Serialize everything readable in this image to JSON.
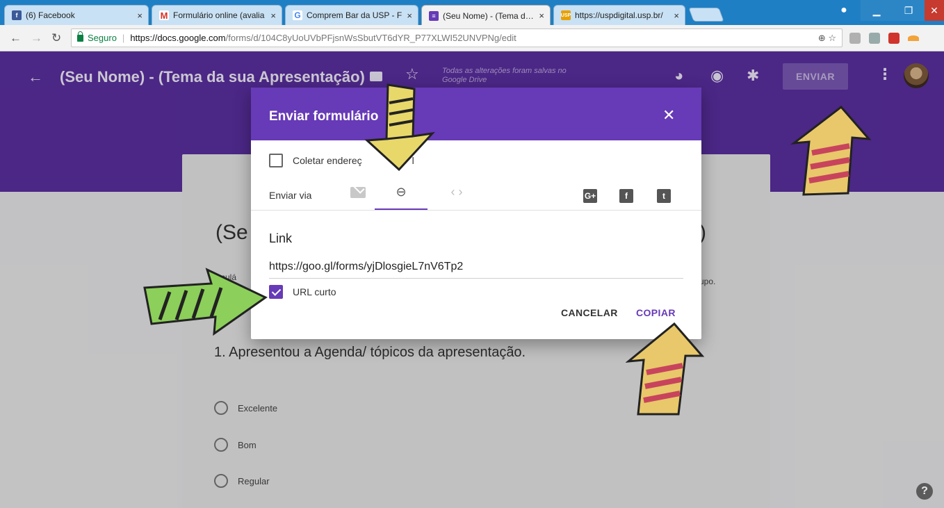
{
  "browser": {
    "tabs": [
      {
        "title": "(6) Facebook",
        "favicon": "facebook-icon",
        "color": "#3b5998"
      },
      {
        "title": "Formulário online (avalia",
        "favicon": "gmail-icon",
        "color": "#d93025"
      },
      {
        "title": "Comprem Bar da USP - F",
        "favicon": "google-icon",
        "color": "#4285f4"
      },
      {
        "title": "(Seu Nome) - (Tema da s",
        "favicon": "forms-icon",
        "color": "#673ab7"
      },
      {
        "title": "https://uspdigital.usp.br/",
        "favicon": "usp-icon",
        "color": "#e8a000"
      }
    ],
    "secure_label": "Seguro",
    "url_host": "https://docs.google.com",
    "url_path": "/forms/d/104C8yUoUVbPFjsnWsSbutVT6dYR_P77XLWI52UNVPNg/edit"
  },
  "forms_header": {
    "title": "(Seu Nome) - (Tema da sua Apresentação)",
    "saved_status": "Todas as alterações foram salvas no Google Drive",
    "send_label": "ENVIAR",
    "accent_color": "#673ab7"
  },
  "form_preview": {
    "title_start": "(Se",
    "title_end": ")",
    "desc_start": "rmulá",
    "desc_end": "upo.",
    "question": "1. Apresentou a Agenda/ tópicos da apresentação.",
    "options": [
      "Excelente",
      "Bom",
      "Regular"
    ]
  },
  "dialog": {
    "title": "Enviar formulário",
    "collect_label": "Coletar endereç",
    "collect_tail": "l",
    "collect_checked": false,
    "send_via_label": "Enviar via",
    "link_label": "Link",
    "link_value": "https://goo.gl/forms/yjDlosgieL7nV6Tp2",
    "short_url_label": "URL curto",
    "short_url_checked": true,
    "cancel_label": "CANCELAR",
    "copy_label": "COPIAR"
  }
}
